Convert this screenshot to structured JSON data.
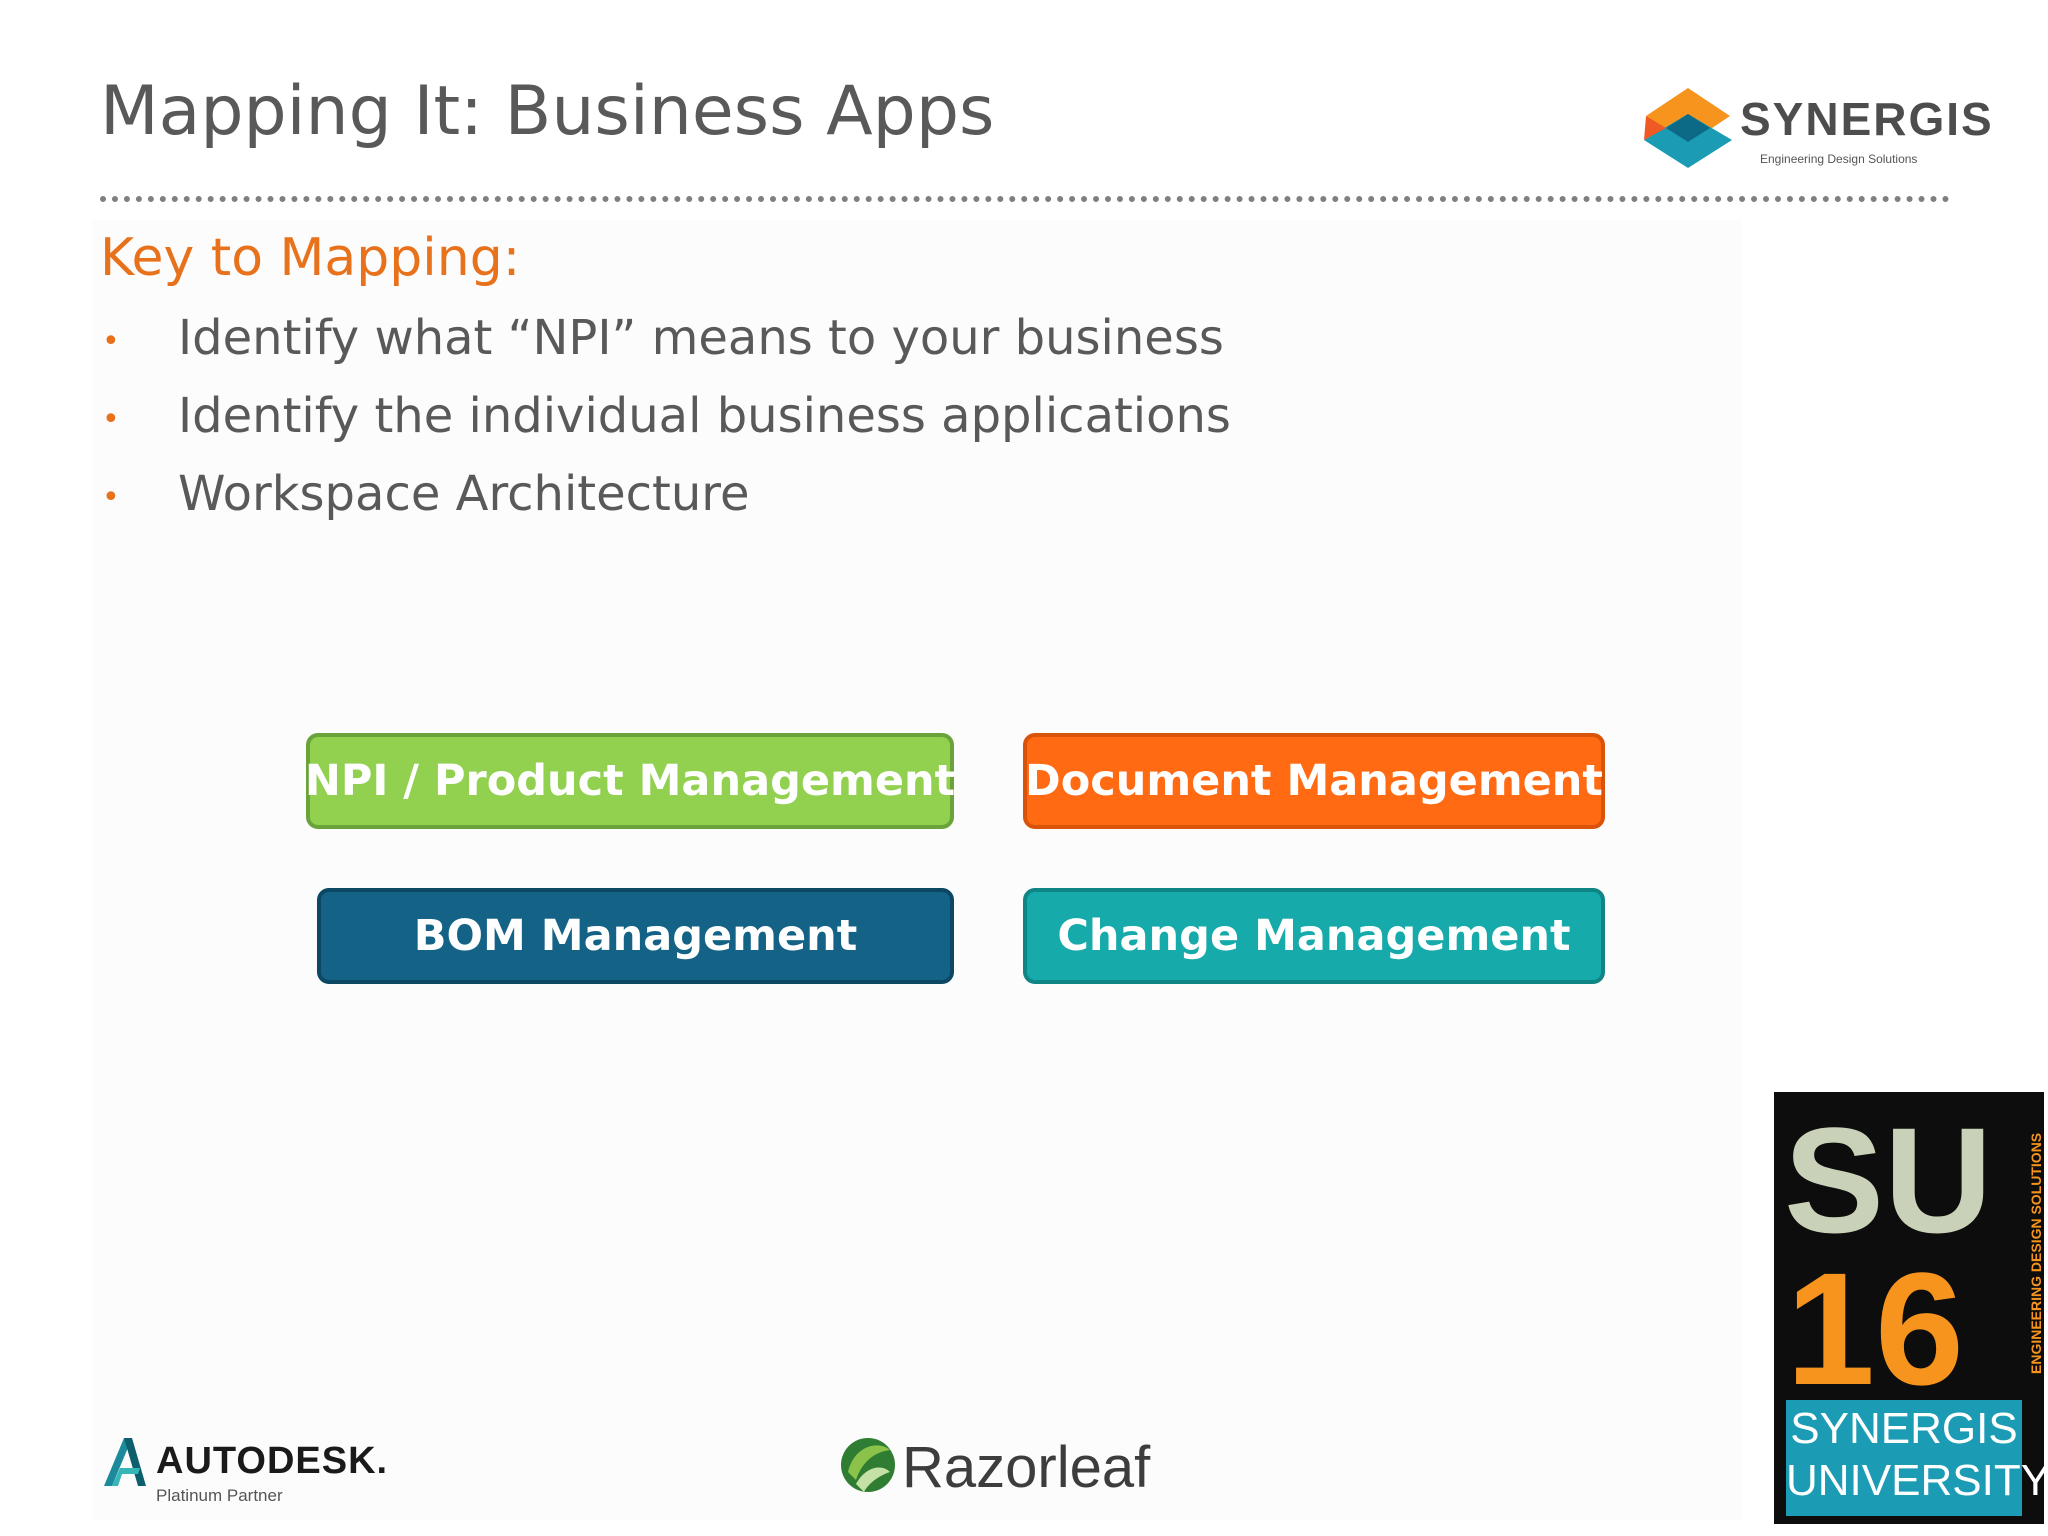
{
  "slide": {
    "title": "Mapping It: Business Apps",
    "section_heading": "Key to Mapping:",
    "bullets": [
      "Identify what “NPI” means to your business",
      "Identify the individual business applications",
      "Workspace Architecture"
    ],
    "bullet_glyph": "•"
  },
  "boxes": {
    "npi": "NPI / Product Management",
    "document": "Document Management",
    "bom": "BOM Management",
    "change": "Change Management"
  },
  "logos": {
    "synergis": {
      "name": "SYNERGIS",
      "tagline": "Engineering Design Solutions"
    },
    "su16": {
      "letters": "SU",
      "year": "16",
      "side_text": "ENGINEERING DESIGN SOLUTIONS",
      "line1": "SYNERGIS",
      "line2": "UNIVERSITY"
    },
    "autodesk": {
      "name": "AUTODESK.",
      "tagline": "Platinum Partner"
    },
    "razorleaf": {
      "name": "Razorleaf"
    }
  },
  "colors": {
    "accent": "#e8711c",
    "npi": "#92d050",
    "document": "#ff6a13",
    "bom": "#146387",
    "change": "#17aaaa"
  }
}
